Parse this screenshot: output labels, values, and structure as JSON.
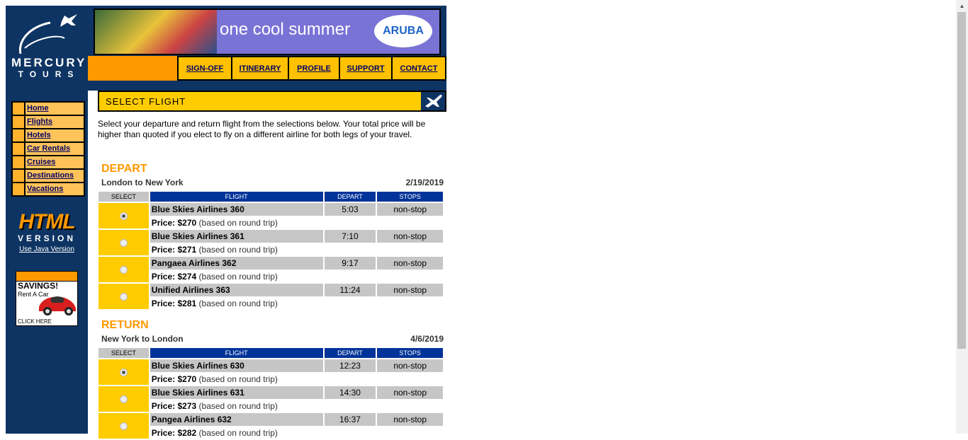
{
  "brand": {
    "line1": "MERCURY",
    "line2": "TOURS"
  },
  "sidebar": {
    "items": [
      {
        "label": "Home"
      },
      {
        "label": "Flights"
      },
      {
        "label": "Hotels"
      },
      {
        "label": "Car Rentals"
      },
      {
        "label": "Cruises"
      },
      {
        "label": "Destinations"
      },
      {
        "label": "Vacations"
      }
    ],
    "html_version": {
      "big": "HTML",
      "small": "VERSION",
      "link": "Use Java Version"
    },
    "ad": {
      "headline": "SAVINGS!",
      "sub": "Rent A Car",
      "cta": "CLICK HERE"
    }
  },
  "banner": {
    "slogan": "one cool summer",
    "brand": "ARUBA"
  },
  "topnav": {
    "items": [
      {
        "label": "SIGN-OFF"
      },
      {
        "label": "ITINERARY"
      },
      {
        "label": "PROFILE"
      },
      {
        "label": "SUPPORT"
      },
      {
        "label": "CONTACT"
      }
    ]
  },
  "page": {
    "title": "SELECT FLIGHT",
    "intro": "Select your departure and return flight from the selections below. Your total price will be higher than quoted if you elect to fly on a different airline for both legs of your travel."
  },
  "columns": {
    "select": "SELECT",
    "flight": "FLIGHT",
    "depart": "DEPART",
    "stops": "STOPS"
  },
  "depart": {
    "heading": "DEPART",
    "route": "London to New York",
    "date": "2/19/2019",
    "flights": [
      {
        "name": "Blue Skies Airlines 360",
        "time": "5:03",
        "stops": "non-stop",
        "price_label": "Price:",
        "price": "$270",
        "note": "(based on round trip)",
        "selected": true
      },
      {
        "name": "Blue Skies Airlines 361",
        "time": "7:10",
        "stops": "non-stop",
        "price_label": "Price:",
        "price": "$271",
        "note": "(based on round trip)",
        "selected": false
      },
      {
        "name": "Pangaea Airlines 362",
        "time": "9:17",
        "stops": "non-stop",
        "price_label": "Price:",
        "price": "$274",
        "note": "(based on round trip)",
        "selected": false
      },
      {
        "name": "Unified Airlines 363",
        "time": "11:24",
        "stops": "non-stop",
        "price_label": "Price:",
        "price": "$281",
        "note": "(based on round trip)",
        "selected": false
      }
    ]
  },
  "return": {
    "heading": "RETURN",
    "route": "New York to London",
    "date": "4/6/2019",
    "flights": [
      {
        "name": "Blue Skies Airlines 630",
        "time": "12:23",
        "stops": "non-stop",
        "price_label": "Price:",
        "price": "$270",
        "note": "(based on round trip)",
        "selected": true
      },
      {
        "name": "Blue Skies Airlines 631",
        "time": "14:30",
        "stops": "non-stop",
        "price_label": "Price:",
        "price": "$273",
        "note": "(based on round trip)",
        "selected": false
      },
      {
        "name": "Pangea Airlines 632",
        "time": "16:37",
        "stops": "non-stop",
        "price_label": "Price:",
        "price": "$282",
        "note": "(based on round trip)",
        "selected": false
      }
    ]
  }
}
